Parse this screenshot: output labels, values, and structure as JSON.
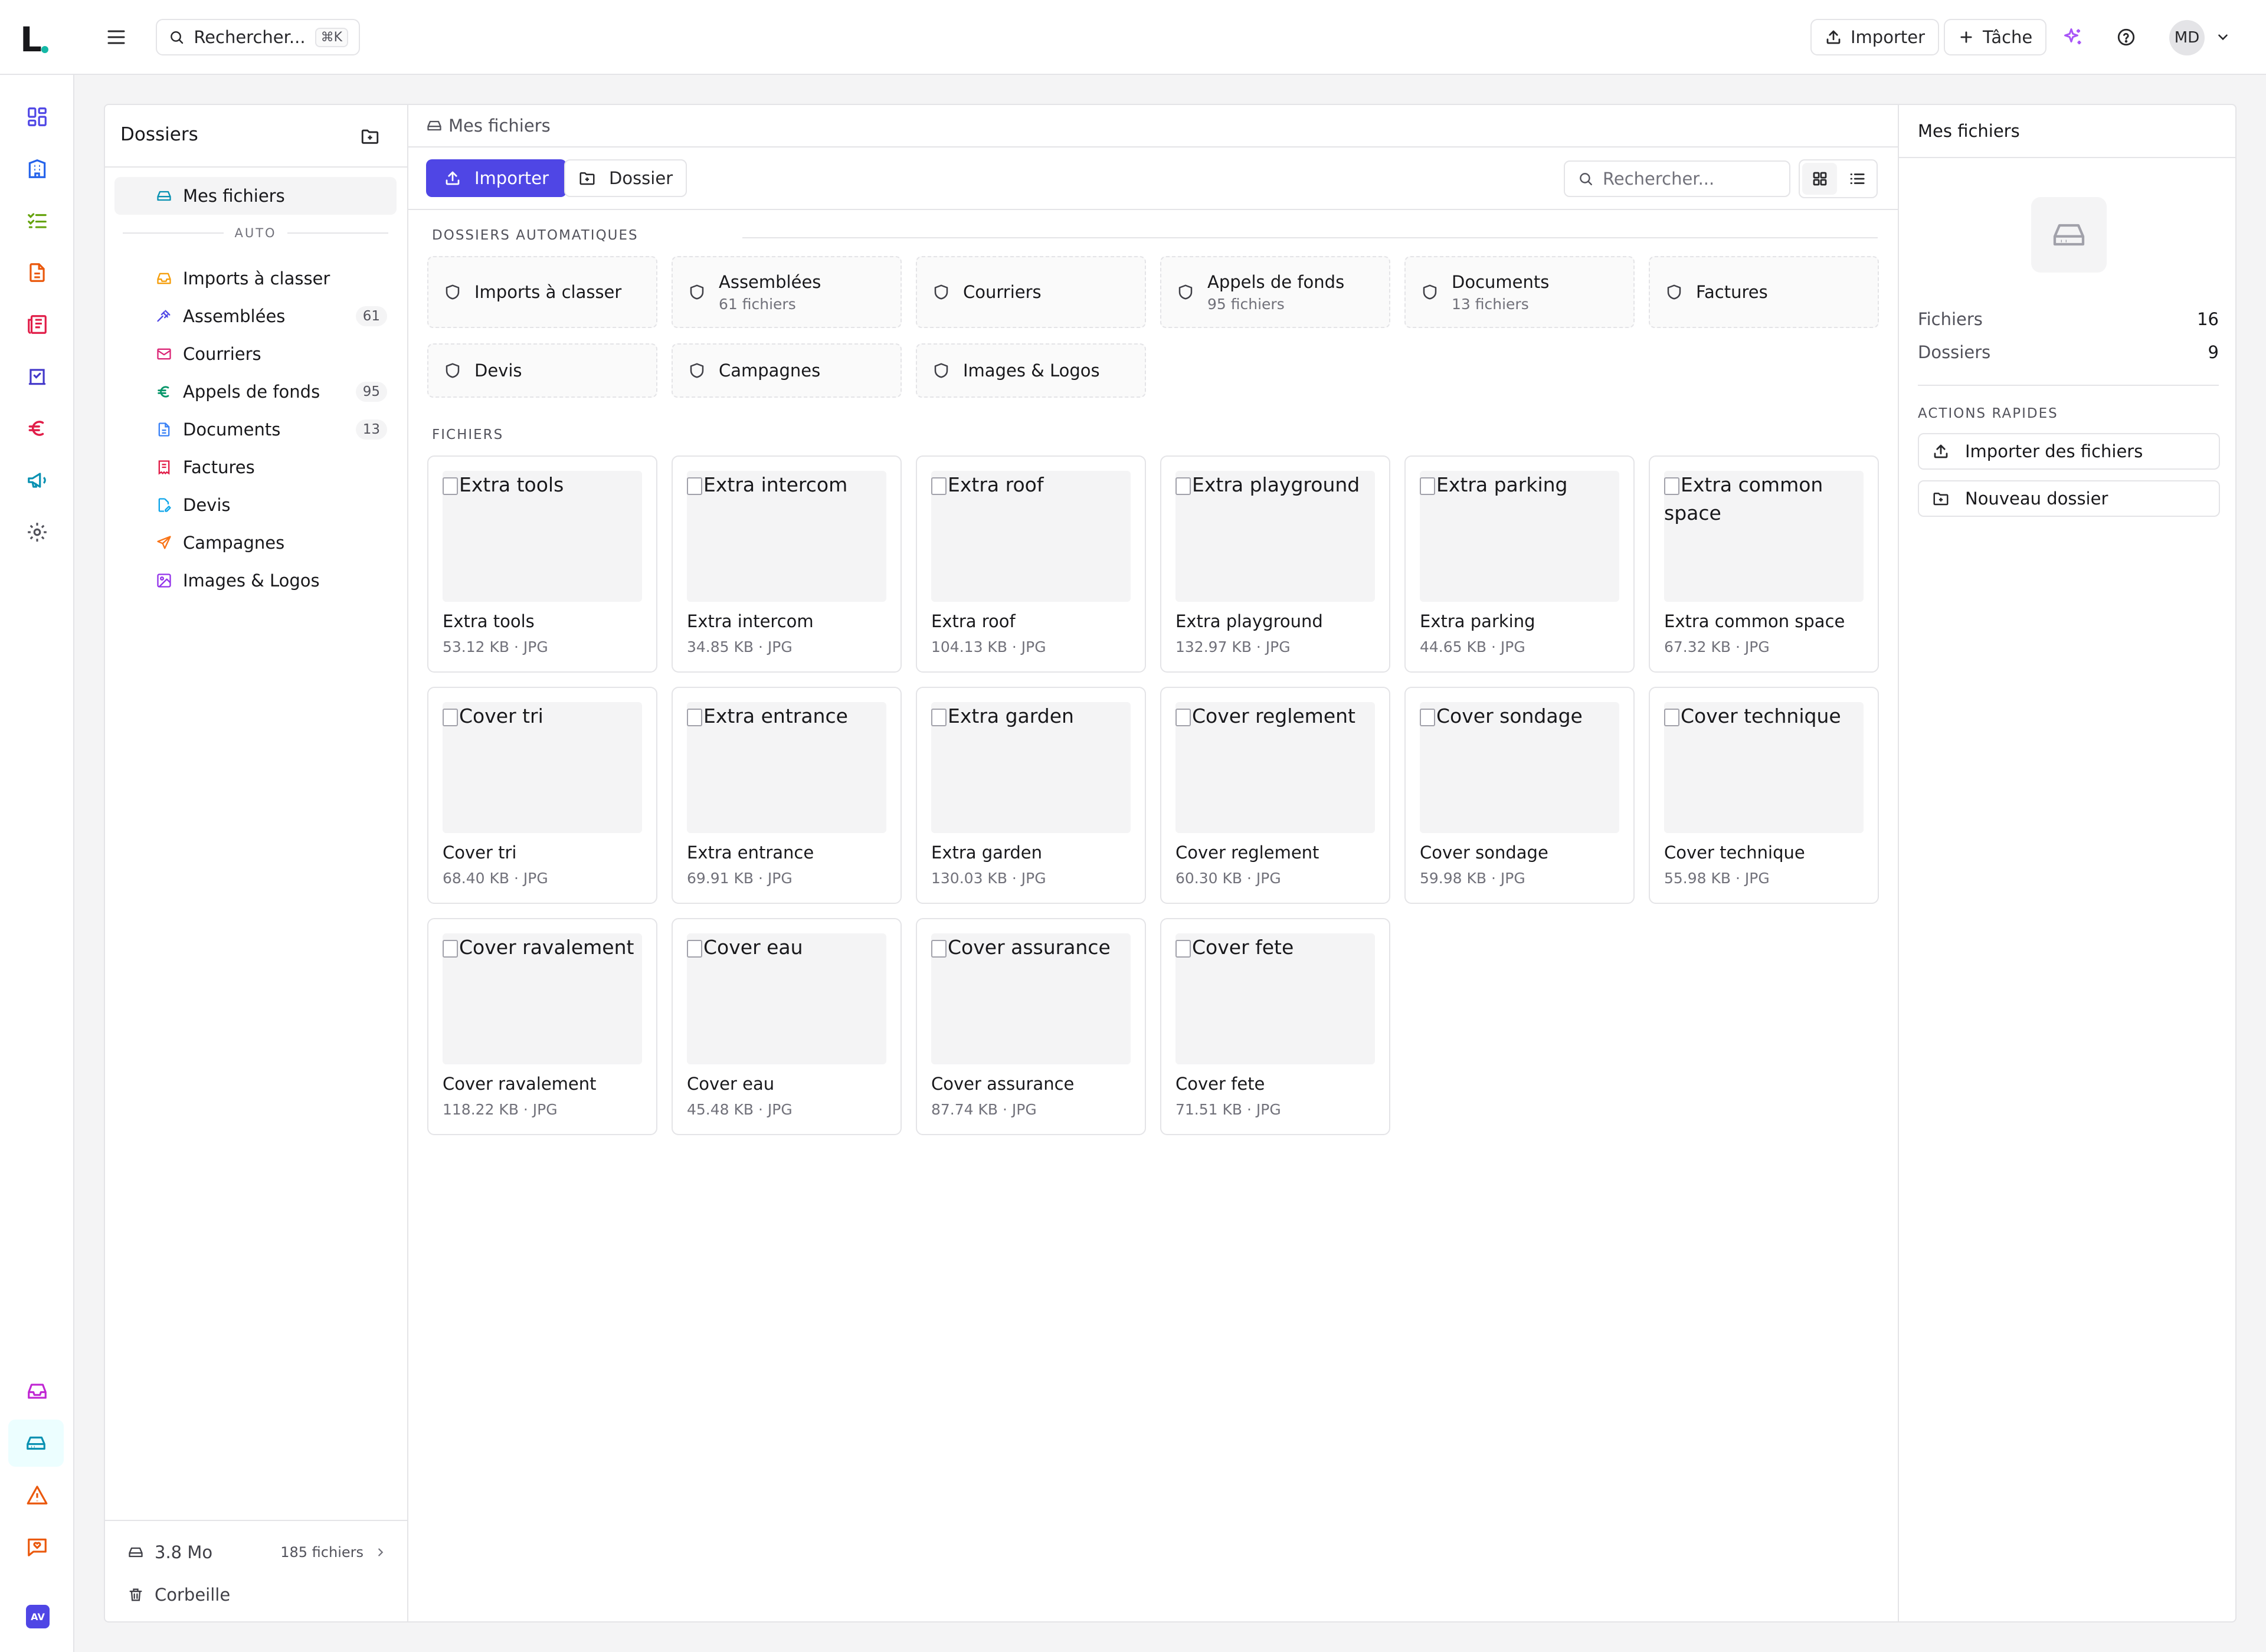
{
  "topbar": {
    "logo": "L",
    "search_label": "Rechercher...",
    "search_shortcut": "⌘K",
    "import_label": "Importer",
    "task_label": "Tâche",
    "avatar_initials": "MD"
  },
  "rail": {
    "bottom_avatar": "AV",
    "colors": {
      "grid": "#4f46e5",
      "building": "#2563eb",
      "tasks": "#65a30d",
      "doc": "#ea580c",
      "news": "#e11d48",
      "check": "#4338ca",
      "euro": "#e11d48",
      "mega": "#0891b2",
      "gear": "#52525b",
      "inbox": "#c026d3",
      "drive": "#0891b2",
      "alert": "#ea580c",
      "chat": "#ea580c"
    }
  },
  "left_panel": {
    "title": "Dossiers",
    "root": {
      "label": "Mes fichiers"
    },
    "auto_label": "AUTO",
    "items": [
      {
        "label": "Imports à classer",
        "icon": "inbox-icon",
        "color": "#f59e0b",
        "count": ""
      },
      {
        "label": "Assemblées",
        "icon": "gavel-icon",
        "color": "#4f46e5",
        "count": "61"
      },
      {
        "label": "Courriers",
        "icon": "mail-icon",
        "color": "#db2777",
        "count": ""
      },
      {
        "label": "Appels de fonds",
        "icon": "euro-icon",
        "color": "#059669",
        "count": "95"
      },
      {
        "label": "Documents",
        "icon": "file-icon",
        "color": "#3b82f6",
        "count": "13"
      },
      {
        "label": "Factures",
        "icon": "receipt-icon",
        "color": "#e11d48",
        "count": ""
      },
      {
        "label": "Devis",
        "icon": "file-edit-icon",
        "color": "#0ea5e9",
        "count": ""
      },
      {
        "label": "Campagnes",
        "icon": "send-icon",
        "color": "#f97316",
        "count": ""
      },
      {
        "label": "Images & Logos",
        "icon": "image-icon",
        "color": "#9333ea",
        "count": ""
      }
    ],
    "storage": "3.8 Mo",
    "files_count": "185 fichiers",
    "trash": "Corbeille"
  },
  "center": {
    "breadcrumb": "Mes fichiers",
    "import_label": "Importer",
    "folder_label": "Dossier",
    "search_placeholder": "Rechercher...",
    "auto_title": "DOSSIERS AUTOMATIQUES",
    "files_title": "FICHIERS",
    "auto_folders": [
      {
        "name": "Imports à classer",
        "count": ""
      },
      {
        "name": "Assemblées",
        "count": "61 fichiers"
      },
      {
        "name": "Courriers",
        "count": ""
      },
      {
        "name": "Appels de fonds",
        "count": "95 fichiers"
      },
      {
        "name": "Documents",
        "count": "13 fichiers"
      },
      {
        "name": "Factures",
        "count": ""
      },
      {
        "name": "Devis",
        "count": ""
      },
      {
        "name": "Campagnes",
        "count": ""
      },
      {
        "name": "Images & Logos",
        "count": ""
      }
    ],
    "files": [
      {
        "alt": "Extra tools",
        "name": "Extra tools",
        "meta": "53.12 KB · JPG"
      },
      {
        "alt": "Extra intercom",
        "name": "Extra intercom",
        "meta": "34.85 KB · JPG"
      },
      {
        "alt": "Extra roof",
        "name": "Extra roof",
        "meta": "104.13 KB · JPG"
      },
      {
        "alt": "Extra playground",
        "name": "Extra playground",
        "meta": "132.97 KB · JPG"
      },
      {
        "alt": "Extra parking",
        "name": "Extra parking",
        "meta": "44.65 KB · JPG"
      },
      {
        "alt": "Extra common space",
        "name": "Extra common space",
        "meta": "67.32 KB · JPG"
      },
      {
        "alt": "Cover tri",
        "name": "Cover tri",
        "meta": "68.40 KB · JPG"
      },
      {
        "alt": "Extra entrance",
        "name": "Extra entrance",
        "meta": "69.91 KB · JPG"
      },
      {
        "alt": "Extra garden",
        "name": "Extra garden",
        "meta": "130.03 KB · JPG"
      },
      {
        "alt": "Cover reglement",
        "name": "Cover reglement",
        "meta": "60.30 KB · JPG"
      },
      {
        "alt": "Cover sondage",
        "name": "Cover sondage",
        "meta": "59.98 KB · JPG"
      },
      {
        "alt": "Cover technique",
        "name": "Cover technique",
        "meta": "55.98 KB · JPG"
      },
      {
        "alt": "Cover ravalement",
        "name": "Cover ravalement",
        "meta": "118.22 KB · JPG"
      },
      {
        "alt": "Cover eau",
        "name": "Cover eau",
        "meta": "45.48 KB · JPG"
      },
      {
        "alt": "Cover assurance",
        "name": "Cover assurance",
        "meta": "87.74 KB · JPG"
      },
      {
        "alt": "Cover fete",
        "name": "Cover fete",
        "meta": "71.51 KB · JPG"
      }
    ]
  },
  "right_panel": {
    "title": "Mes fichiers",
    "files_label": "Fichiers",
    "files_value": "16",
    "folders_label": "Dossiers",
    "folders_value": "9",
    "quick_title": "ACTIONS RAPIDES",
    "import_files": "Importer des fichiers",
    "new_folder": "Nouveau dossier"
  },
  "colors": {
    "accent": "#4f46e5",
    "border": "#e4e4e7",
    "muted": "#71717a"
  }
}
